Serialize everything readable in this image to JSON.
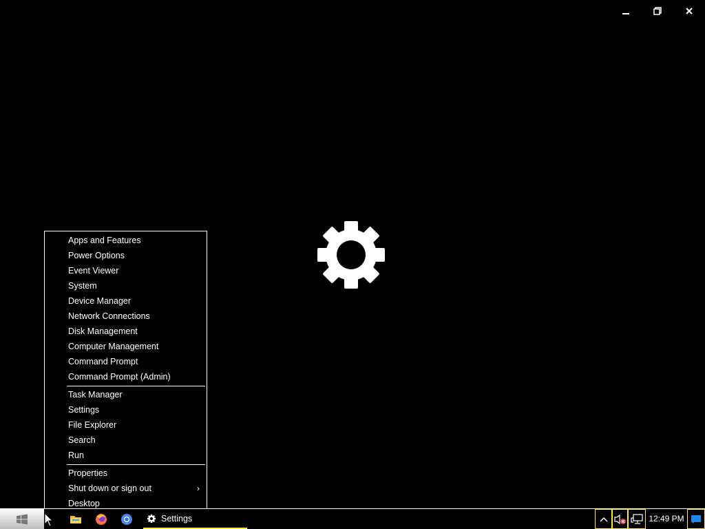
{
  "caption": {
    "minimize_icon": "minimize-icon",
    "restore_icon": "restore-icon",
    "close_icon": "close-icon"
  },
  "splash": {
    "icon": "gear-icon",
    "color": "#ffffff"
  },
  "menu": {
    "group1": [
      "Apps and Features",
      "Power Options",
      "Event Viewer",
      "System",
      "Device Manager",
      "Network Connections",
      "Disk Management",
      "Computer Management",
      "Command Prompt",
      "Command Prompt (Admin)"
    ],
    "group2": [
      "Task Manager",
      "Settings",
      "File Explorer",
      "Search",
      "Run"
    ],
    "group3": [
      "Properties",
      "Shut down or sign out",
      "Desktop"
    ],
    "submenu_arrow": "›"
  },
  "taskbar": {
    "active_app_label": "Settings",
    "clock": "12:49 PM",
    "accent": "#ffeb3b"
  }
}
